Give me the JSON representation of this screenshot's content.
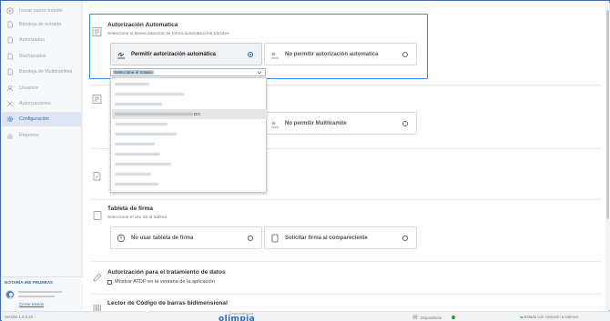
{
  "sidebar": {
    "items": [
      {
        "label": "Iniciar nuevo trámite",
        "icon": "plus-circle-icon",
        "active": false
      },
      {
        "label": "Bandeja de entrada",
        "icon": "document-icon",
        "active": false
      },
      {
        "label": "Autorizados",
        "icon": "document-icon",
        "active": false
      },
      {
        "label": "Rechazados",
        "icon": "document-icon",
        "active": false
      },
      {
        "label": "Bandeja de Multitrámites",
        "icon": "document-icon",
        "active": false
      },
      {
        "label": "Usuarios",
        "icon": "user-icon",
        "active": false
      },
      {
        "label": "Autorizaciones",
        "icon": "tools-icon",
        "active": false
      },
      {
        "label": "Configuración",
        "icon": "gear-icon",
        "active": true
      },
      {
        "label": "Reportes",
        "icon": "bar-chart-icon",
        "active": false
      }
    ]
  },
  "user": {
    "title": "NOTARÍA 360 PRUEBAS",
    "logout": "Cerrar Sesión"
  },
  "footer": {
    "version": "Versión 1.0.0.22",
    "developed_by": "Desarrollado por",
    "brand": "olimpia",
    "devices": "Dispositivos",
    "connection": "Estado con conexión a internet"
  },
  "auto_auth": {
    "title": "Autorización Automatica",
    "subtitle": "Seleccione si desea autorizar de forma automatica los trámites",
    "option_allow": "Permitir autorización automática",
    "option_deny": "No permitir autorización automatica",
    "select_value": "Seleccione el notario",
    "dropdown_suffix": "DO"
  },
  "multitramite": {
    "option_deny": "No permitir Multitramite"
  },
  "signature_tablet": {
    "title": "Tableta de firma",
    "subtitle": "Seleccione el uso de la tableta",
    "option_none": "No usar tableta de firma",
    "option_request": "Solicitar firma al compareciente"
  },
  "data_auth": {
    "title": "Autorización para el tratamiento de datos",
    "checkbox_label": "Mostrar ATDP en la ventana de la aplicación"
  },
  "barcode": {
    "title": "Lector de Código de barras bidimensional"
  },
  "colors": {
    "accent": "#2e6db4",
    "focus": "#3b88d6",
    "online": "#2e9b3d"
  }
}
